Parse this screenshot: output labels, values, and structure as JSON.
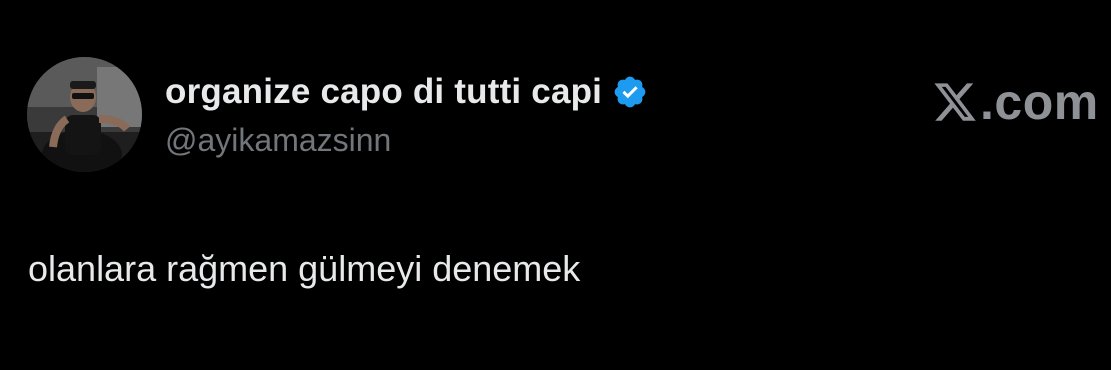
{
  "tweet": {
    "author": {
      "display_name": "organize capo di tutti capi",
      "handle": "@ayikamazsinn",
      "verified": true,
      "verified_icon": "verified-badge-icon",
      "avatar": "avatar"
    },
    "text": "olanlara rağmen gülmeyi denemek"
  },
  "brand": {
    "logo_icon": "x-logo-icon",
    "domain_suffix": ".com"
  },
  "colors": {
    "background": "#000000",
    "primary_text": "#e7e9ea",
    "secondary_text": "#71767b",
    "verified_blue": "#1d9bf0",
    "brand_gray": "#8e9196"
  }
}
